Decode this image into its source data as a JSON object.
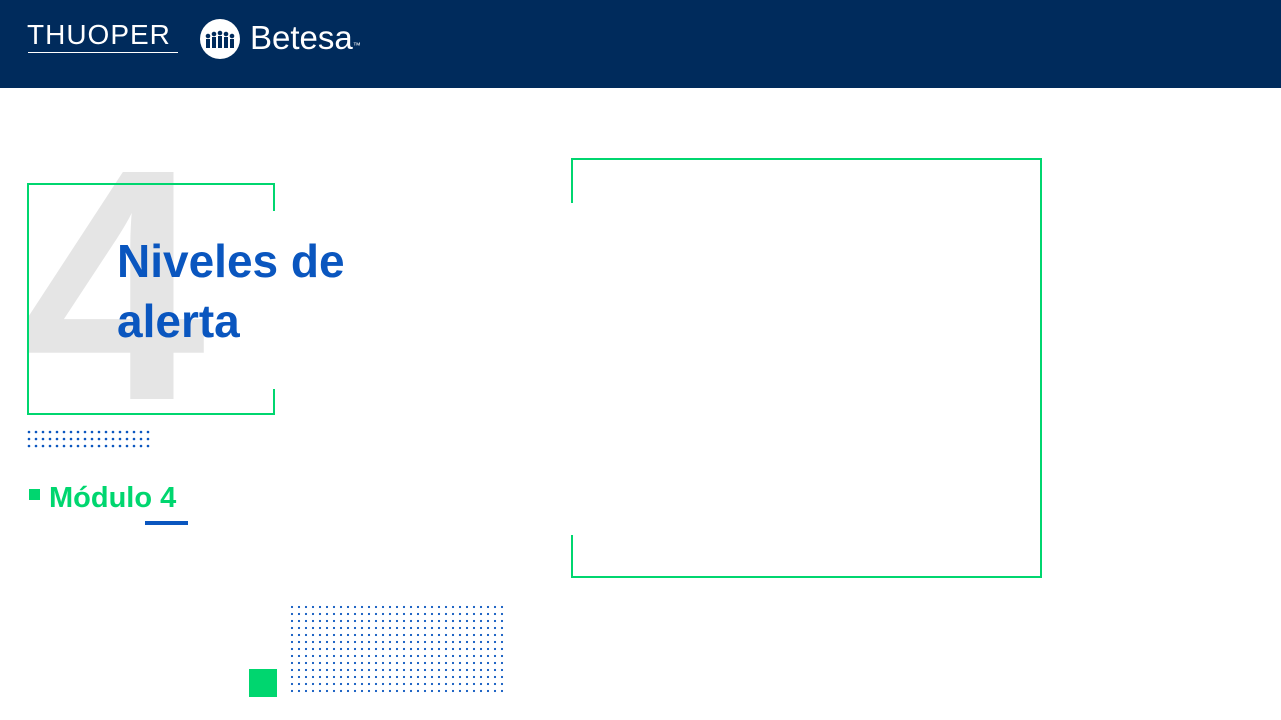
{
  "header": {
    "logo_primary": "THUOPER",
    "logo_secondary": "Betesa",
    "logo_secondary_mark": "™"
  },
  "slide": {
    "number": "4",
    "title_line1": "Niveles de",
    "title_line2": "alerta",
    "module_label": "Módulo 4"
  },
  "colors": {
    "header_bg": "#002b5c",
    "accent_blue": "#0a56bf",
    "accent_green": "#00d66f",
    "number_gray": "#e5e5e5"
  }
}
